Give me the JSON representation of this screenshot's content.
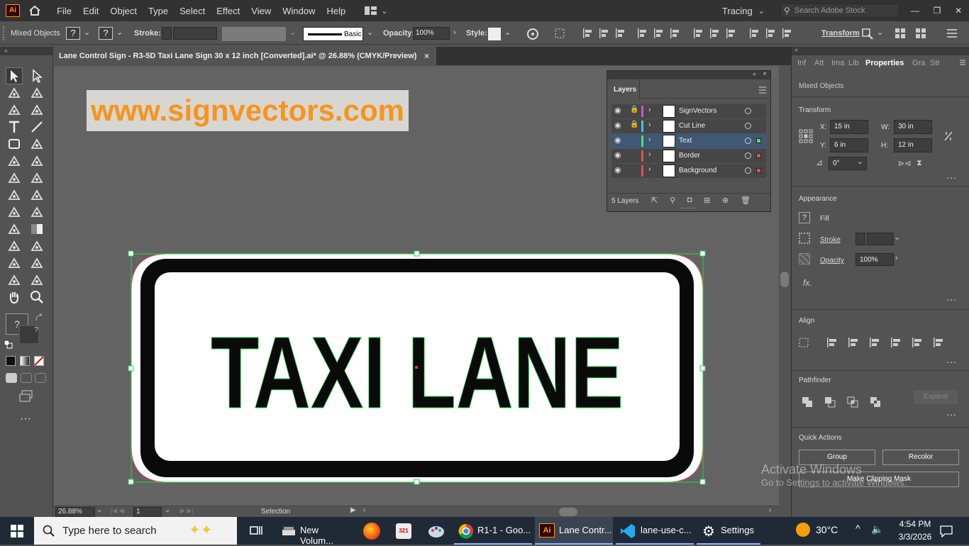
{
  "app_logo": "Ai",
  "menus": [
    "File",
    "Edit",
    "Object",
    "Type",
    "Select",
    "Effect",
    "View",
    "Window",
    "Help"
  ],
  "workspace": "Tracing",
  "search_placeholder": "Search Adobe Stock",
  "control": {
    "selection_label": "Mixed Objects",
    "stroke_label": "Stroke:",
    "brush_label": "Basic",
    "opacity_label": "Opacity:",
    "opacity_value": "100%",
    "style_label": "Style:",
    "transform_label": "Transform"
  },
  "document_tab": "Lane Control Sign - R3-5D Taxi Lane Sign 30 x 12 inch [Converted].ai* @ 26.88% (CMYK/Preview)",
  "watermark_text": "www.signvectors.com",
  "sign_text": "TAXI LANE",
  "layers_panel": {
    "title": "Layers",
    "count_label": "5 Layers",
    "layers": [
      {
        "name": "SignVectors",
        "color": "#d94ce0",
        "locked": true
      },
      {
        "name": "Cut Line",
        "color": "#38c7e8",
        "locked": true
      },
      {
        "name": "Text",
        "color": "#4ce06c",
        "locked": false,
        "selected": true
      },
      {
        "name": "Border",
        "color": "#e84c4c",
        "locked": false
      },
      {
        "name": "Background",
        "color": "#e84c4c",
        "locked": false
      }
    ]
  },
  "properties": {
    "tabs": [
      "Info",
      "Att",
      "Ima",
      "Lib",
      "Properties",
      "Gra",
      "Str"
    ],
    "active_tab": "Properties",
    "selection": "Mixed Objects",
    "transform": {
      "title": "Transform",
      "x": "15 in",
      "y": "6 in",
      "w": "30 in",
      "h": "12 in",
      "angle": "0°"
    },
    "appearance": {
      "title": "Appearance",
      "fill": "Fill",
      "stroke": "Stroke",
      "opacity_label": "Opacity",
      "opacity": "100%",
      "fx": "fx."
    },
    "align_title": "Align",
    "pathfinder_title": "Pathfinder",
    "expand_label": "Expand",
    "quick_actions": {
      "title": "Quick Actions",
      "group": "Group",
      "recolor": "Recolor",
      "clipping": "Make Clipping Mask"
    }
  },
  "status": {
    "zoom": "26.88%",
    "artboard": "1",
    "tool": "Selection"
  },
  "activate_windows": {
    "title": "Activate Windows",
    "subtitle": "Go to Settings to activate Windows."
  },
  "taskbar": {
    "search_placeholder": "Type here to search",
    "apps": [
      "New Volum...",
      "R1-1 - Goo...",
      "Lane Contr...",
      "lane-use-c...",
      "Settings"
    ],
    "temperature": "30°C",
    "time": "4:54 PM",
    "date": "3/3/2026"
  },
  "colors": {
    "accent_orange": "#f7941d",
    "selection_green": "#2bd14a",
    "sign_black": "#0a0a0a"
  }
}
